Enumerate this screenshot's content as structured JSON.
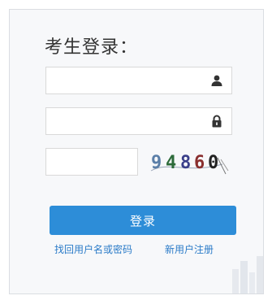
{
  "title": "考生登录：",
  "username": {
    "value": "",
    "icon": "user-icon"
  },
  "password": {
    "value": "",
    "icon": "lock-icon"
  },
  "captcha": {
    "value": "",
    "code": [
      "9",
      "4",
      "8",
      "6",
      "0"
    ],
    "colors": [
      "#5b7fa8",
      "#2d6b3a",
      "#3a3f8a",
      "#8a2f2f",
      "#222222"
    ]
  },
  "login_button": "登录",
  "links": {
    "forgot": "找回用户名或密码",
    "register": "新用户注册"
  },
  "colors": {
    "button": "#2d8dd8",
    "link": "#2b7bc8",
    "panel_bg": "#f7f8fa",
    "panel_border": "#dadde2"
  }
}
